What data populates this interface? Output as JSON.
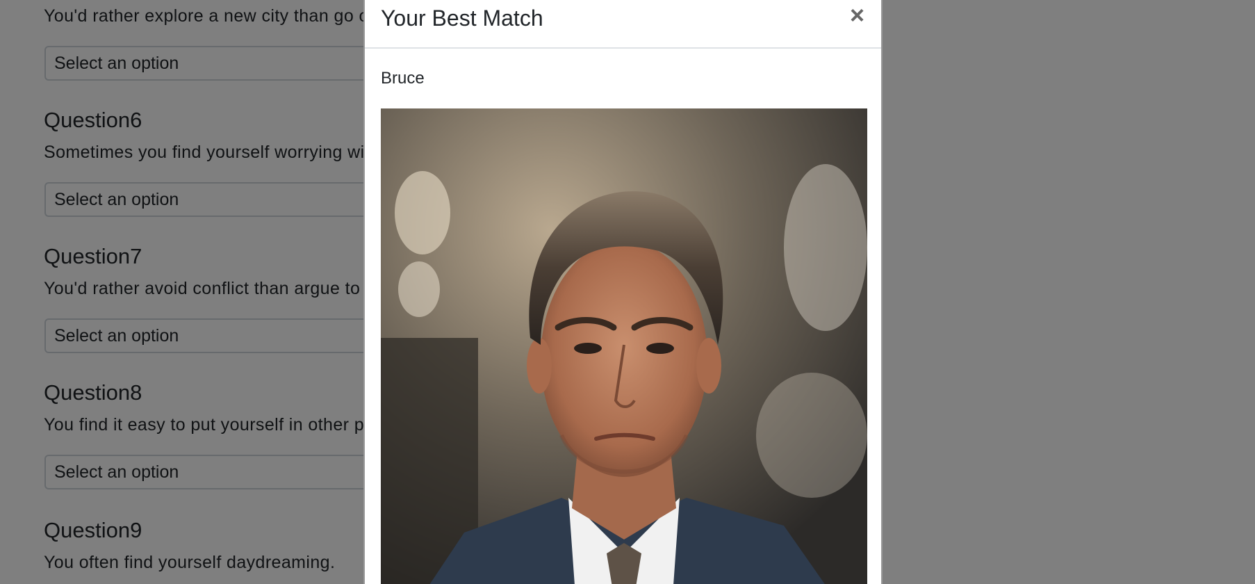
{
  "survey": {
    "questions": [
      {
        "title": "",
        "text": "You'd rather explore a new city than go o",
        "select_value": "Select an option"
      },
      {
        "title": "Question6",
        "text": "Sometimes you find yourself worrying wit",
        "select_value": "Select an option"
      },
      {
        "title": "Question7",
        "text": "You'd rather avoid conflict than argue to",
        "select_value": "Select an option"
      },
      {
        "title": "Question8",
        "text": "You find it easy to put yourself in other p",
        "select_value": "Select an option"
      },
      {
        "title": "Question9",
        "text": "You often find yourself daydreaming.",
        "select_value": ""
      }
    ]
  },
  "modal": {
    "title": "Your Best Match",
    "close_label": "×",
    "match_name": "Bruce",
    "photo_icon": "person-portrait-photo"
  }
}
